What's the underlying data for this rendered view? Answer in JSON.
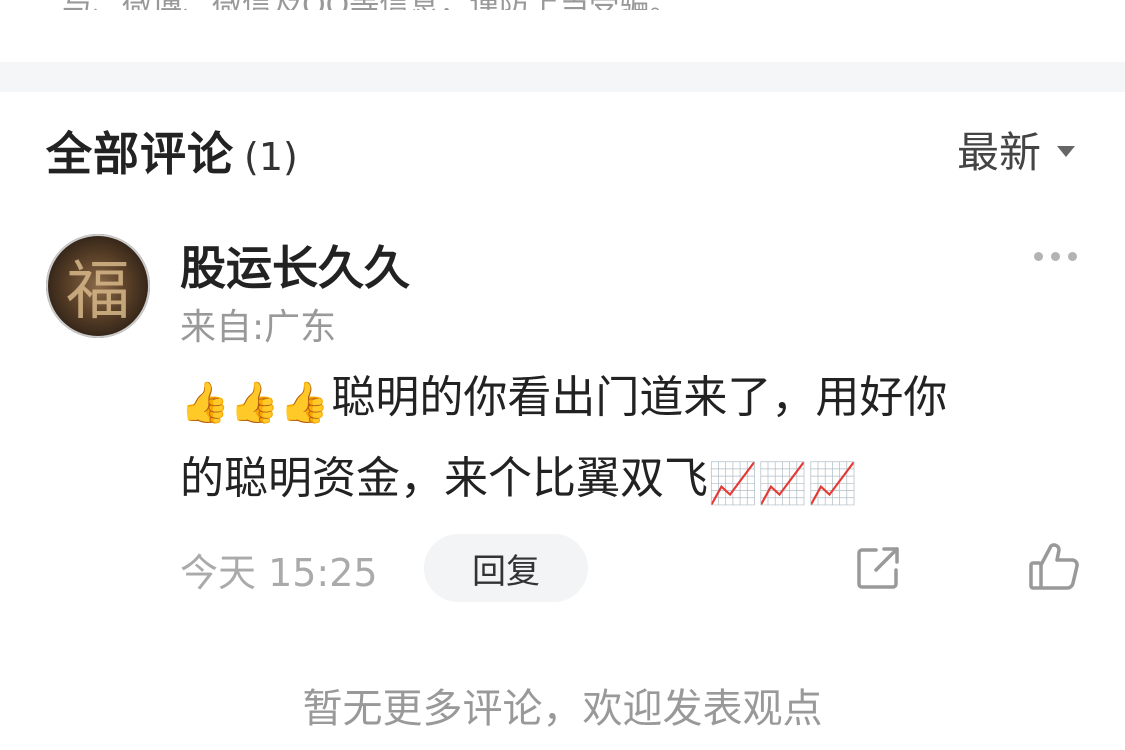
{
  "top_truncated_text": "与、微博、微信及QQ等信息，谨防上当受骗。",
  "comments": {
    "title": "全部评论",
    "count": "(1)",
    "sort_label": "最新"
  },
  "comment": {
    "username": "股运长久久",
    "location": "来自:广东",
    "line1_emojis": "👍👍👍",
    "line1_text": "聪明的你看出门道来了，用好你",
    "line2_text": "的聪明资金，来个比翼双飞",
    "line2_emojis": "📈📈📈",
    "timestamp": "今天 15:25",
    "reply_label": "回复"
  },
  "footer": {
    "text": "暂无更多评论，欢迎发表观点"
  },
  "colors": {
    "divider": "#f5f6f8",
    "secondary_text": "#999999",
    "primary_text": "#222222"
  }
}
